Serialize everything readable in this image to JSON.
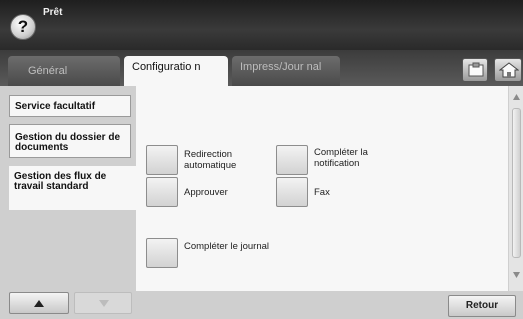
{
  "header": {
    "help_label": "?",
    "status": "Prêt"
  },
  "tabs": [
    {
      "label": "Général"
    },
    {
      "label": "Configuratio n"
    },
    {
      "label": "Impress/Jour nal"
    }
  ],
  "toolbar": {
    "icons": [
      "clipboard-icon",
      "home-icon"
    ]
  },
  "sidebar": {
    "items": [
      {
        "label": "Service facultatif"
      },
      {
        "label": "Gestion du dossier de documents"
      },
      {
        "label": "Gestion des flux de travail standard"
      }
    ]
  },
  "options": [
    {
      "label": "Redirection automatique"
    },
    {
      "label": "Compléter la notification"
    },
    {
      "label": "Approuver"
    },
    {
      "label": "Fax"
    },
    {
      "label": "Compléter le journal"
    }
  ],
  "footer": {
    "back_label": "Retour"
  }
}
